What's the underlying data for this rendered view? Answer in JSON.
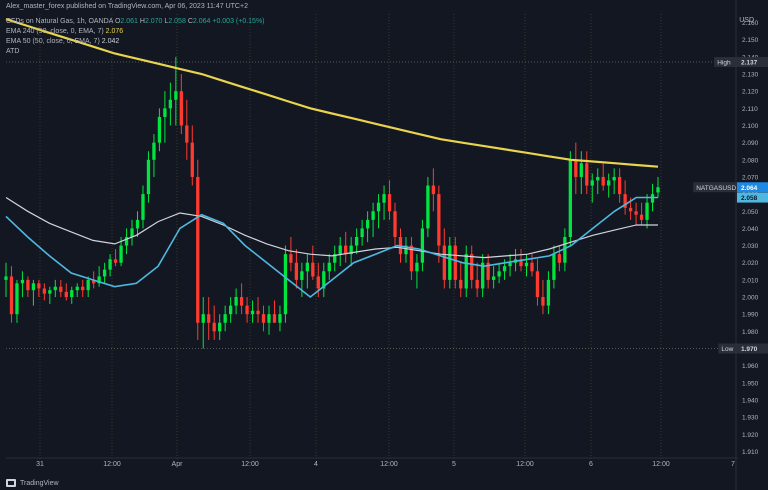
{
  "header": {
    "publisher_line": "Alex_master_forex published on TradingView.com, Apr 06, 2023 11:47 UTC+2"
  },
  "legend": {
    "symbol_line": {
      "title": "CFDs on Natural Gas, 1h, OANDA",
      "open_label": "O",
      "open": "2.061",
      "high_label": "H",
      "high": "2.070",
      "low_label": "L",
      "low": "2.058",
      "close_label": "C",
      "close": "2.064",
      "change": "+0.003 (+0.15%)"
    },
    "ema240": {
      "label": "EMA",
      "params": "240 (50, close, 0, EMA, 7)",
      "value": "2.076"
    },
    "ema50": {
      "label": "EMA",
      "params": "50 (50, close, 0, EMA, 7)",
      "value": "2.042"
    },
    "atd": {
      "label": "ATD"
    }
  },
  "price_axis": {
    "unit": "USD",
    "ticks": [
      "2.160",
      "2.150",
      "2.140",
      "2.130",
      "2.120",
      "2.110",
      "2.100",
      "2.090",
      "2.080",
      "2.070",
      "2.060",
      "2.050",
      "2.040",
      "2.030",
      "2.020",
      "2.010",
      "2.000",
      "1.990",
      "1.980",
      "1.960",
      "1.950",
      "1.940",
      "1.930",
      "1.920",
      "1.910"
    ]
  },
  "time_axis": {
    "ticks": [
      "31",
      "12:00",
      "Apr",
      "12:00",
      "4",
      "12:00",
      "5",
      "12:00",
      "6",
      "12:00",
      "7"
    ]
  },
  "markers": {
    "high": {
      "label": "High",
      "value": "2.137"
    },
    "low": {
      "label": "Low",
      "value": "1.970"
    },
    "symbol": {
      "label": "NATGASUSD",
      "value": "2.064"
    },
    "ema_tag": {
      "value": "2.058"
    }
  },
  "footer": {
    "brand": "TradingView"
  },
  "colors": {
    "background": "#131722",
    "up": "#00e640",
    "down": "#ff3b30",
    "ema240": "#e8d44d",
    "ema50": "#4fb8e0",
    "ema_slow": "#d1d4dc",
    "grid": "#3a3a2a"
  },
  "chart_data": {
    "type": "candlestick",
    "ylim": [
      1.905,
      2.165
    ],
    "x_range": [
      0,
      183
    ],
    "x_ticks": [
      {
        "x": 8,
        "label": "31"
      },
      {
        "x": 28,
        "label": "12:00"
      },
      {
        "x": 47,
        "label": "Apr"
      },
      {
        "x": 68,
        "label": "12:00"
      },
      {
        "x": 87,
        "label": "4"
      },
      {
        "x": 107,
        "label": "12:00"
      },
      {
        "x": 126,
        "label": "5"
      },
      {
        "x": 146,
        "label": "12:00"
      },
      {
        "x": 165,
        "label": "6"
      },
      {
        "x": 185,
        "label": "12:00"
      },
      {
        "x": 205,
        "label": "7"
      }
    ],
    "candles": [
      [
        0,
        2.01,
        2.02,
        2.0,
        2.012
      ],
      [
        1,
        2.012,
        2.018,
        1.985,
        1.99
      ],
      [
        2,
        1.99,
        2.01,
        1.985,
        2.008
      ],
      [
        3,
        2.008,
        2.015,
        2.0,
        2.01
      ],
      [
        4,
        2.01,
        2.012,
        2.0,
        2.004
      ],
      [
        5,
        2.004,
        2.01,
        1.995,
        2.008
      ],
      [
        6,
        2.008,
        2.01,
        2.0,
        2.005
      ],
      [
        7,
        2.005,
        2.008,
        1.998,
        2.002
      ],
      [
        8,
        2.002,
        2.006,
        1.996,
        2.004
      ],
      [
        9,
        2.004,
        2.01,
        2.0,
        2.006
      ],
      [
        10,
        2.006,
        2.01,
        2.0,
        2.003
      ],
      [
        11,
        2.003,
        2.008,
        1.998,
        2.0
      ],
      [
        12,
        2.0,
        2.006,
        1.996,
        2.004
      ],
      [
        13,
        2.004,
        2.008,
        2.0,
        2.006
      ],
      [
        14,
        2.006,
        2.01,
        2.0,
        2.004
      ],
      [
        15,
        2.004,
        2.012,
        2.0,
        2.01
      ],
      [
        16,
        2.01,
        2.015,
        2.005,
        2.008
      ],
      [
        17,
        2.008,
        2.018,
        2.006,
        2.012
      ],
      [
        18,
        2.012,
        2.02,
        2.008,
        2.016
      ],
      [
        19,
        2.016,
        2.025,
        2.012,
        2.022
      ],
      [
        20,
        2.022,
        2.028,
        2.018,
        2.02
      ],
      [
        21,
        2.02,
        2.035,
        2.018,
        2.03
      ],
      [
        22,
        2.03,
        2.04,
        2.025,
        2.035
      ],
      [
        23,
        2.035,
        2.045,
        2.03,
        2.04
      ],
      [
        24,
        2.04,
        2.05,
        2.035,
        2.045
      ],
      [
        25,
        2.045,
        2.065,
        2.04,
        2.06
      ],
      [
        26,
        2.06,
        2.085,
        2.055,
        2.08
      ],
      [
        27,
        2.08,
        2.095,
        2.07,
        2.09
      ],
      [
        28,
        2.09,
        2.11,
        2.085,
        2.105
      ],
      [
        29,
        2.105,
        2.12,
        2.09,
        2.11
      ],
      [
        30,
        2.11,
        2.125,
        2.1,
        2.115
      ],
      [
        31,
        2.115,
        2.14,
        2.1,
        2.12
      ],
      [
        32,
        2.12,
        2.13,
        2.095,
        2.1
      ],
      [
        33,
        2.1,
        2.115,
        2.08,
        2.09
      ],
      [
        34,
        2.09,
        2.1,
        2.065,
        2.07
      ],
      [
        35,
        2.07,
        2.08,
        1.975,
        1.985
      ],
      [
        36,
        1.985,
        2.0,
        1.97,
        1.99
      ],
      [
        37,
        1.99,
        2.0,
        1.975,
        1.985
      ],
      [
        38,
        1.985,
        1.995,
        1.975,
        1.98
      ],
      [
        39,
        1.98,
        1.99,
        1.975,
        1.985
      ],
      [
        40,
        1.985,
        1.995,
        1.98,
        1.99
      ],
      [
        41,
        1.99,
        2.0,
        1.985,
        1.995
      ],
      [
        42,
        1.995,
        2.005,
        1.99,
        2.0
      ],
      [
        43,
        2.0,
        2.008,
        1.99,
        1.995
      ],
      [
        44,
        1.995,
        2.0,
        1.985,
        1.99
      ],
      [
        45,
        1.99,
        1.998,
        1.985,
        1.992
      ],
      [
        46,
        1.992,
        2.0,
        1.985,
        1.99
      ],
      [
        47,
        1.99,
        1.995,
        1.98,
        1.985
      ],
      [
        48,
        1.985,
        1.995,
        1.978,
        1.99
      ],
      [
        49,
        1.99,
        1.998,
        1.985,
        1.985
      ],
      [
        50,
        1.985,
        1.995,
        1.98,
        1.99
      ],
      [
        51,
        1.99,
        2.03,
        1.985,
        2.025
      ],
      [
        52,
        2.025,
        2.035,
        2.015,
        2.02
      ],
      [
        53,
        2.02,
        2.028,
        2.005,
        2.01
      ],
      [
        54,
        2.01,
        2.02,
        2.0,
        2.015
      ],
      [
        55,
        2.015,
        2.025,
        2.005,
        2.02
      ],
      [
        56,
        2.02,
        2.03,
        2.01,
        2.012
      ],
      [
        57,
        2.012,
        2.02,
        2.0,
        2.005
      ],
      [
        58,
        2.005,
        2.02,
        2.0,
        2.015
      ],
      [
        59,
        2.015,
        2.025,
        2.01,
        2.02
      ],
      [
        60,
        2.02,
        2.03,
        2.015,
        2.025
      ],
      [
        61,
        2.025,
        2.035,
        2.018,
        2.03
      ],
      [
        62,
        2.03,
        2.038,
        2.02,
        2.025
      ],
      [
        63,
        2.025,
        2.035,
        2.018,
        2.03
      ],
      [
        64,
        2.03,
        2.04,
        2.025,
        2.035
      ],
      [
        65,
        2.035,
        2.045,
        2.03,
        2.04
      ],
      [
        66,
        2.04,
        2.05,
        2.032,
        2.045
      ],
      [
        67,
        2.045,
        2.055,
        2.035,
        2.05
      ],
      [
        68,
        2.05,
        2.06,
        2.04,
        2.055
      ],
      [
        69,
        2.055,
        2.065,
        2.045,
        2.06
      ],
      [
        70,
        2.06,
        2.068,
        2.045,
        2.05
      ],
      [
        71,
        2.05,
        2.055,
        2.03,
        2.035
      ],
      [
        72,
        2.035,
        2.04,
        2.02,
        2.025
      ],
      [
        73,
        2.025,
        2.035,
        2.02,
        2.03
      ],
      [
        74,
        2.03,
        2.035,
        2.01,
        2.015
      ],
      [
        75,
        2.015,
        2.025,
        2.005,
        2.02
      ],
      [
        76,
        2.02,
        2.045,
        2.015,
        2.04
      ],
      [
        77,
        2.04,
        2.07,
        2.035,
        2.065
      ],
      [
        78,
        2.065,
        2.075,
        2.05,
        2.06
      ],
      [
        79,
        2.06,
        2.065,
        2.02,
        2.03
      ],
      [
        80,
        2.03,
        2.04,
        2.005,
        2.01
      ],
      [
        81,
        2.01,
        2.035,
        2.005,
        2.03
      ],
      [
        82,
        2.03,
        2.035,
        2.005,
        2.01
      ],
      [
        83,
        2.01,
        2.02,
        2.0,
        2.005
      ],
      [
        84,
        2.005,
        2.03,
        2.0,
        2.025
      ],
      [
        85,
        2.025,
        2.03,
        2.005,
        2.01
      ],
      [
        86,
        2.01,
        2.02,
        2.0,
        2.005
      ],
      [
        87,
        2.005,
        2.025,
        2.0,
        2.02
      ],
      [
        88,
        2.02,
        2.025,
        2.005,
        2.01
      ],
      [
        89,
        2.01,
        2.018,
        2.005,
        2.012
      ],
      [
        90,
        2.012,
        2.02,
        2.008,
        2.015
      ],
      [
        91,
        2.015,
        2.022,
        2.01,
        2.018
      ],
      [
        92,
        2.018,
        2.025,
        2.012,
        2.02
      ],
      [
        93,
        2.02,
        2.028,
        2.015,
        2.022
      ],
      [
        94,
        2.022,
        2.028,
        2.015,
        2.018
      ],
      [
        95,
        2.018,
        2.025,
        2.012,
        2.02
      ],
      [
        96,
        2.02,
        2.025,
        2.012,
        2.015
      ],
      [
        97,
        2.015,
        2.022,
        1.995,
        2.0
      ],
      [
        98,
        2.0,
        2.01,
        1.99,
        1.995
      ],
      [
        99,
        1.995,
        2.015,
        1.99,
        2.01
      ],
      [
        100,
        2.01,
        2.03,
        2.005,
        2.025
      ],
      [
        101,
        2.025,
        2.03,
        2.015,
        2.02
      ],
      [
        102,
        2.02,
        2.04,
        2.015,
        2.035
      ],
      [
        103,
        2.035,
        2.085,
        2.03,
        2.08
      ],
      [
        104,
        2.08,
        2.09,
        2.06,
        2.07
      ],
      [
        105,
        2.07,
        2.085,
        2.06,
        2.078
      ],
      [
        106,
        2.078,
        2.085,
        2.06,
        2.065
      ],
      [
        107,
        2.065,
        2.072,
        2.055,
        2.068
      ],
      [
        108,
        2.068,
        2.075,
        2.06,
        2.07
      ],
      [
        109,
        2.07,
        2.078,
        2.062,
        2.065
      ],
      [
        110,
        2.065,
        2.072,
        2.058,
        2.068
      ],
      [
        111,
        2.068,
        2.075,
        2.06,
        2.07
      ],
      [
        112,
        2.07,
        2.075,
        2.055,
        2.06
      ],
      [
        113,
        2.06,
        2.068,
        2.048,
        2.052
      ],
      [
        114,
        2.052,
        2.058,
        2.045,
        2.05
      ],
      [
        115,
        2.05,
        2.055,
        2.042,
        2.048
      ],
      [
        116,
        2.048,
        2.055,
        2.042,
        2.045
      ],
      [
        117,
        2.045,
        2.06,
        2.04,
        2.055
      ],
      [
        118,
        2.055,
        2.066,
        2.05,
        2.06
      ],
      [
        119,
        2.061,
        2.07,
        2.058,
        2.064
      ]
    ],
    "ema240": [
      2.162,
      2.158,
      2.154,
      2.15,
      2.146,
      2.142,
      2.139,
      2.136,
      2.133,
      2.13,
      2.126,
      2.122,
      2.118,
      2.114,
      2.11,
      2.107,
      2.104,
      2.101,
      2.098,
      2.095,
      2.092,
      2.09,
      2.088,
      2.086,
      2.084,
      2.082,
      2.08,
      2.079,
      2.078,
      2.077,
      2.076
    ],
    "ema50": [
      2.047,
      2.035,
      2.024,
      2.014,
      2.01,
      2.006,
      2.008,
      2.018,
      2.04,
      2.048,
      2.043,
      2.03,
      2.02,
      2.01,
      2.0,
      2.01,
      2.02,
      2.025,
      2.03,
      2.028,
      2.024,
      2.02,
      2.018,
      2.02,
      2.022,
      2.024,
      2.03,
      2.04,
      2.05,
      2.058,
      2.058
    ],
    "ema_slow": [
      2.058,
      2.05,
      2.043,
      2.038,
      2.033,
      2.031,
      2.036,
      2.044,
      2.049,
      2.047,
      2.042,
      2.036,
      2.031,
      2.027,
      2.025,
      2.024,
      2.026,
      2.028,
      2.029,
      2.027,
      2.025,
      2.024,
      2.023,
      2.024,
      2.025,
      2.028,
      2.032,
      2.036,
      2.039,
      2.042,
      2.042
    ]
  }
}
